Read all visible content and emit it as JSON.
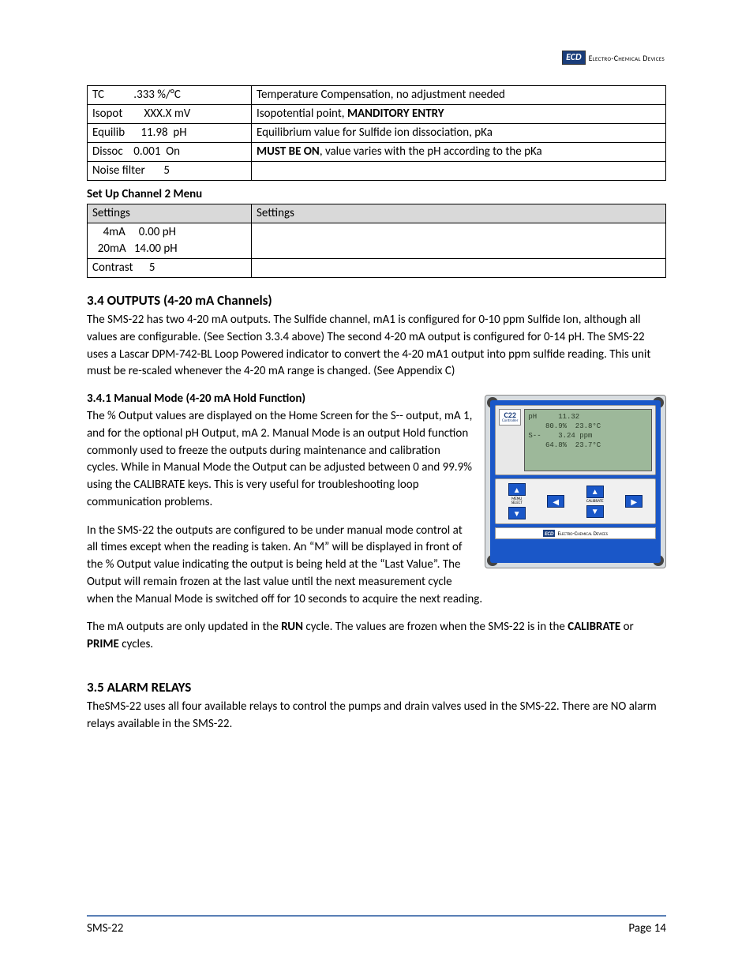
{
  "brand": {
    "logo_abbr": "ECD",
    "logo_full": "Electro-Chemical Devices"
  },
  "table1": {
    "rows": [
      {
        "left": "TC           .333 %/°C",
        "right_plain": "Temperature Compensation, no adjustment needed"
      },
      {
        "left": "Isopot        XXX.X mV",
        "right_pre": "Isopotential point, ",
        "right_bold": "MANDITORY ENTRY"
      },
      {
        "left": "Equilib      11.98  pH",
        "right_plain": "Equilibrium value for Sulfide ion dissociation, pKa"
      },
      {
        "left": "Dissoc    0.001  On",
        "right_bold_pre": "MUST BE ON",
        "right_post": ", value varies with the pH according to the pKa"
      },
      {
        "left": "Noise filter       5",
        "right_plain": ""
      }
    ]
  },
  "setup_label": "Set Up Channel 2 Menu",
  "table2": {
    "header_left": "Settings",
    "header_right": "Settings",
    "row1_left": "    4mA     0.00 pH\n  20mA   14.00 pH",
    "row2_left": "Contrast      5"
  },
  "sec34": {
    "heading": "3.4 OUTPUTS (4-20 mA Channels)",
    "para1": "The SMS-22 has two 4-20 mA outputs. The Sulfide channel, mA1 is configured for 0-10 ppm Sulfide Ion, although all values are configurable. (See Section 3.3.4 above) The second 4-20 mA output is configured for 0-14 pH. The SMS-22 uses a Lascar DPM-742-BL Loop Powered indicator to convert the 4-20 mA1 output into ppm sulfide reading. This unit must be re-scaled whenever the 4-20 mA range is changed. (See Appendix C)"
  },
  "sec341": {
    "heading": "3.4.1 Manual Mode (4-20 mA Hold Function)",
    "para1": "The % Output values are displayed on the Home Screen for the S-- output, mA 1, and for the optional pH Output, mA 2. Manual Mode is an output Hold function commonly used to freeze the outputs during maintenance and calibration cycles. While in Manual Mode the Output can be adjusted between 0 and 99.9% using the CALIBRATE keys. This is very useful for troubleshooting loop communication problems.",
    "para2": "In the SMS-22 the outputs are configured to be under manual mode control at all times except when the reading is taken. An “M” will be displayed in front of the % Output value indicating the output is being held at the “Last Value”. The Output will remain frozen at the last value until the next measurement cycle when the Manual Mode is switched off for 10 seconds to acquire the next reading.",
    "para3_pre": "The mA outputs are only updated in the ",
    "para3_b1": "RUN",
    "para3_mid": " cycle. The values are frozen when the SMS-22 is in the ",
    "para3_b2": "CALIBRATE",
    "para3_or": " or ",
    "para3_b3": "PRIME",
    "para3_post": " cycles."
  },
  "sec35": {
    "heading": "3.5 ALARM RELAYS",
    "para": "TheSMS-22 uses all four available relays to control the pumps and drain valves used in the SMS-22. There are NO alarm relays available in the SMS-22."
  },
  "device_fig": {
    "model": "C22",
    "model_sub": "Controller",
    "lcd_line1": "pH     11.32",
    "lcd_line2": "    80.9%  23.8°C",
    "lcd_line3": "S--    3.24 ppm",
    "lcd_line4": "    64.8%  23.7°C",
    "btn_menu": "MENU\nSELECT",
    "btn_cal": "CALIBRATE",
    "footer_brand": "ECD",
    "footer_text": "Electro-Chemical Devices"
  },
  "footer": {
    "left": "SMS-22",
    "right": "Page 14"
  }
}
